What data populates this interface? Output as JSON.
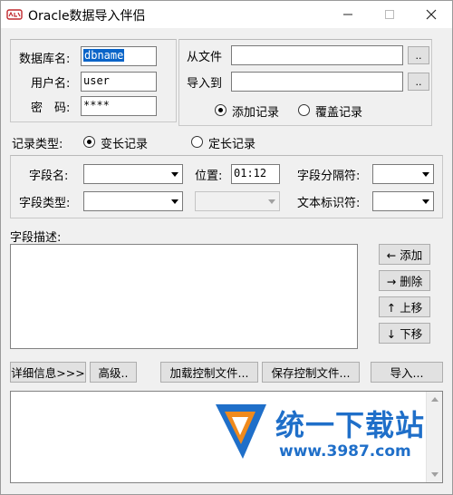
{
  "window": {
    "title": "Oracle数据导入伴侣"
  },
  "db": {
    "name_label": "数据库名:",
    "name_value": "dbname",
    "user_label": "用户名:",
    "user_value": "user",
    "pwd_label": "密　码:",
    "pwd_value": "****"
  },
  "files": {
    "from_label": "从文件",
    "from_value": "",
    "to_label": "导入到",
    "to_value": "",
    "browse_label": "..",
    "append_label": "添加记录",
    "overwrite_label": "覆盖记录",
    "mode_selected": "append"
  },
  "record_type": {
    "label": "记录类型:",
    "variable_label": "变长记录",
    "fixed_label": "定长记录",
    "selected": "variable"
  },
  "field_def": {
    "name_label": "字段名:",
    "position_label": "位置:",
    "position_value": "01:12",
    "separator_label": "字段分隔符:",
    "type_label": "字段类型:",
    "text_qualifier_label": "文本标识符:"
  },
  "desc": {
    "label": "字段描述:",
    "add_label": "← 添加",
    "delete_label": "→ 删除",
    "up_label": "↑ 上移",
    "down_label": "↓ 下移"
  },
  "actions": {
    "details_label": "详细信息>>>",
    "advanced_label": "高级..",
    "load_ctl_label": "加载控制文件...",
    "save_ctl_label": "保存控制文件...",
    "import_label": "导入..."
  },
  "watermark": {
    "brand_text": "统一下载站",
    "url_text": "www.3987.com"
  },
  "colors": {
    "selection": "#0a64c8",
    "watermark_blue": "#1f6fc9",
    "watermark_orange": "#f08a1c"
  }
}
